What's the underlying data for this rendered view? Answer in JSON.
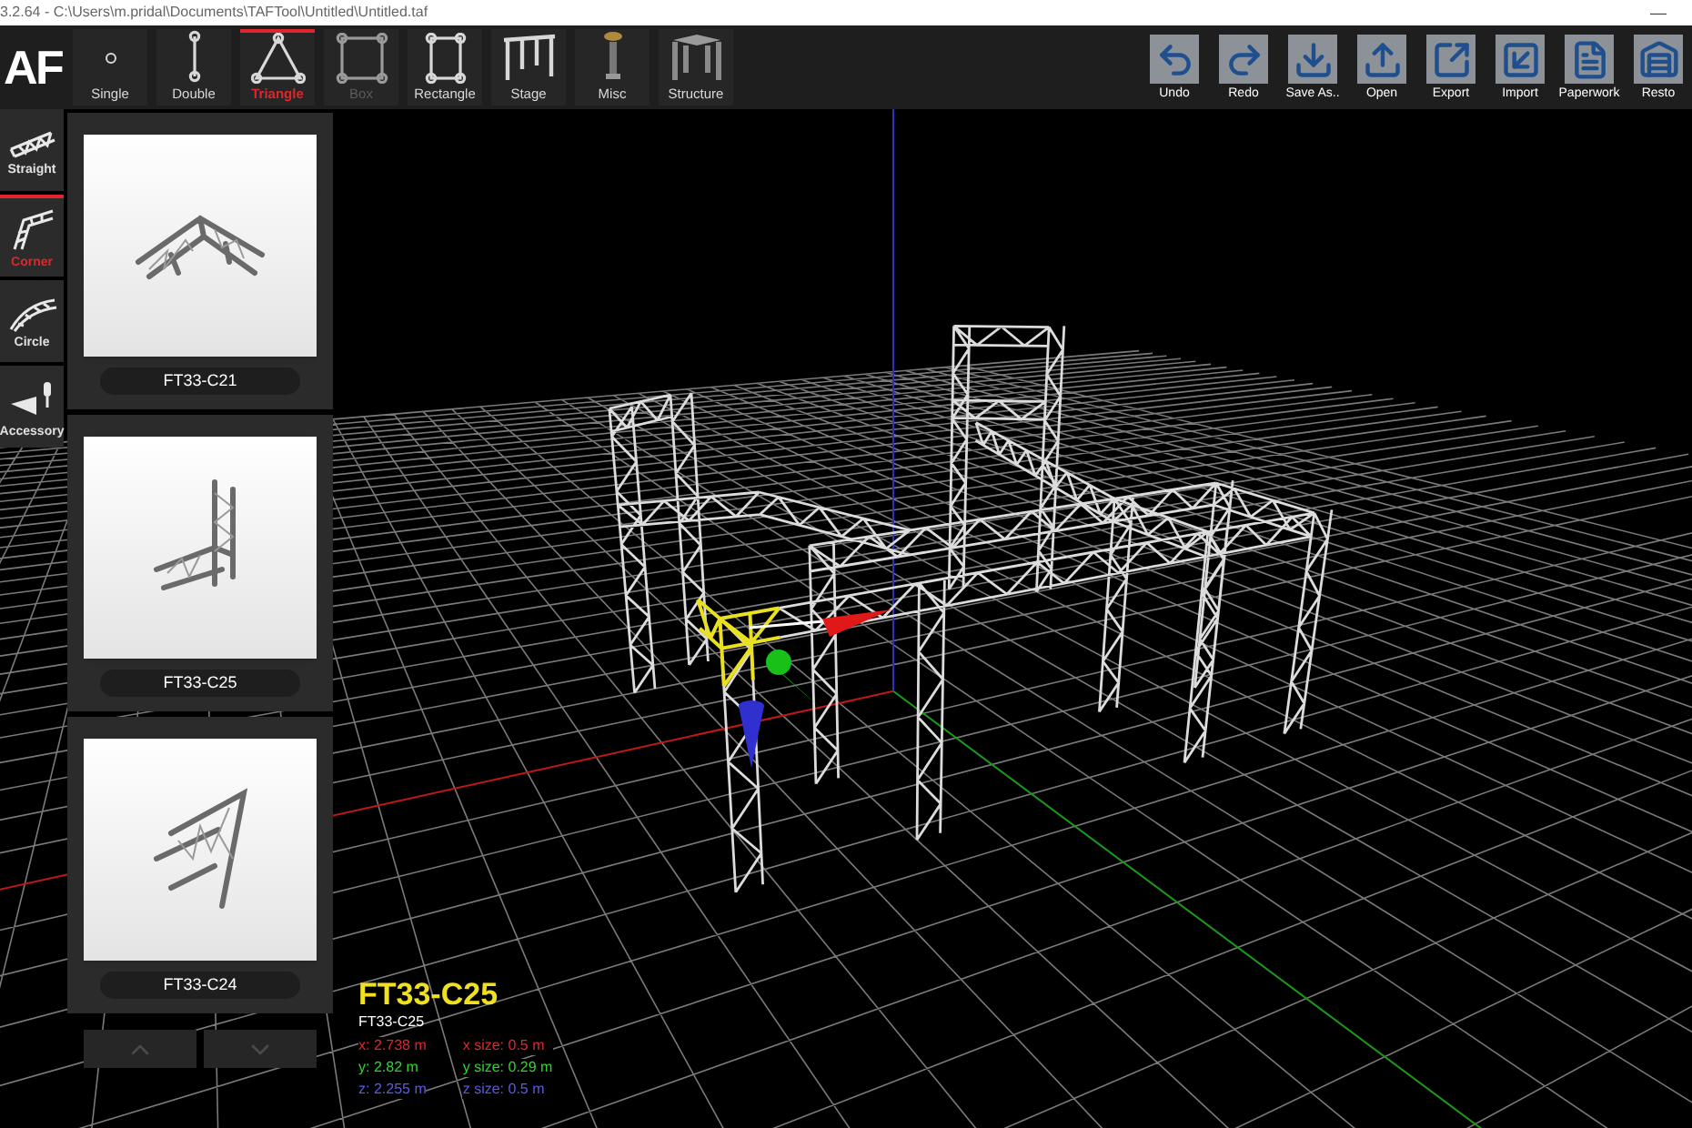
{
  "title_bar": {
    "text": "3.2.64 - C:\\Users\\m.pridal\\Documents\\TAFTool\\Untitled\\Untitled.taf",
    "minimize": "—"
  },
  "logo": "AF",
  "tabs": [
    {
      "label": "Single",
      "kind": "single",
      "selected": false,
      "disabled": false
    },
    {
      "label": "Double",
      "kind": "double",
      "selected": false,
      "disabled": false
    },
    {
      "label": "Triangle",
      "kind": "triangle",
      "selected": true,
      "disabled": false
    },
    {
      "label": "Box",
      "kind": "box",
      "selected": false,
      "disabled": true
    },
    {
      "label": "Rectangle",
      "kind": "rectangle",
      "selected": false,
      "disabled": false
    },
    {
      "label": "Stage",
      "kind": "stage",
      "selected": false,
      "disabled": false
    },
    {
      "label": "Misc",
      "kind": "misc",
      "selected": false,
      "disabled": false
    },
    {
      "label": "Structure",
      "kind": "structure",
      "selected": false,
      "disabled": false
    }
  ],
  "actions": [
    {
      "label": "Undo",
      "kind": "undo"
    },
    {
      "label": "Redo",
      "kind": "redo"
    },
    {
      "label": "Save As..",
      "kind": "save"
    },
    {
      "label": "Open",
      "kind": "open"
    },
    {
      "label": "Export",
      "kind": "export"
    },
    {
      "label": "Import",
      "kind": "import"
    },
    {
      "label": "Paperwork",
      "kind": "paperwork"
    },
    {
      "label": "Resto",
      "kind": "restore"
    }
  ],
  "categories": [
    {
      "label": "Straight",
      "kind": "straight",
      "selected": false
    },
    {
      "label": "Corner",
      "kind": "corner",
      "selected": true
    },
    {
      "label": "Circle",
      "kind": "circle",
      "selected": false
    },
    {
      "label": "Accessory",
      "kind": "accessory",
      "selected": false
    }
  ],
  "products": [
    {
      "name": "FT33-C21",
      "kind": "flat"
    },
    {
      "name": "FT33-C25",
      "kind": "upright"
    },
    {
      "name": "FT33-C24",
      "kind": "angled"
    }
  ],
  "selection": {
    "name": "FT33-C25",
    "subtitle": "FT33-C25",
    "readouts": [
      {
        "text": "x: 2.738 m",
        "color": "#e0262b"
      },
      {
        "text": "x size: 0.5 m",
        "color": "#e0262b"
      },
      {
        "text": "y: 2.82 m",
        "color": "#2bd62b"
      },
      {
        "text": "y size: 0.29 m",
        "color": "#2bd62b"
      },
      {
        "text": "z: 2.255 m",
        "color": "#5a5ae6"
      },
      {
        "text": "z size: 0.5 m",
        "color": "#5a5ae6"
      }
    ]
  }
}
